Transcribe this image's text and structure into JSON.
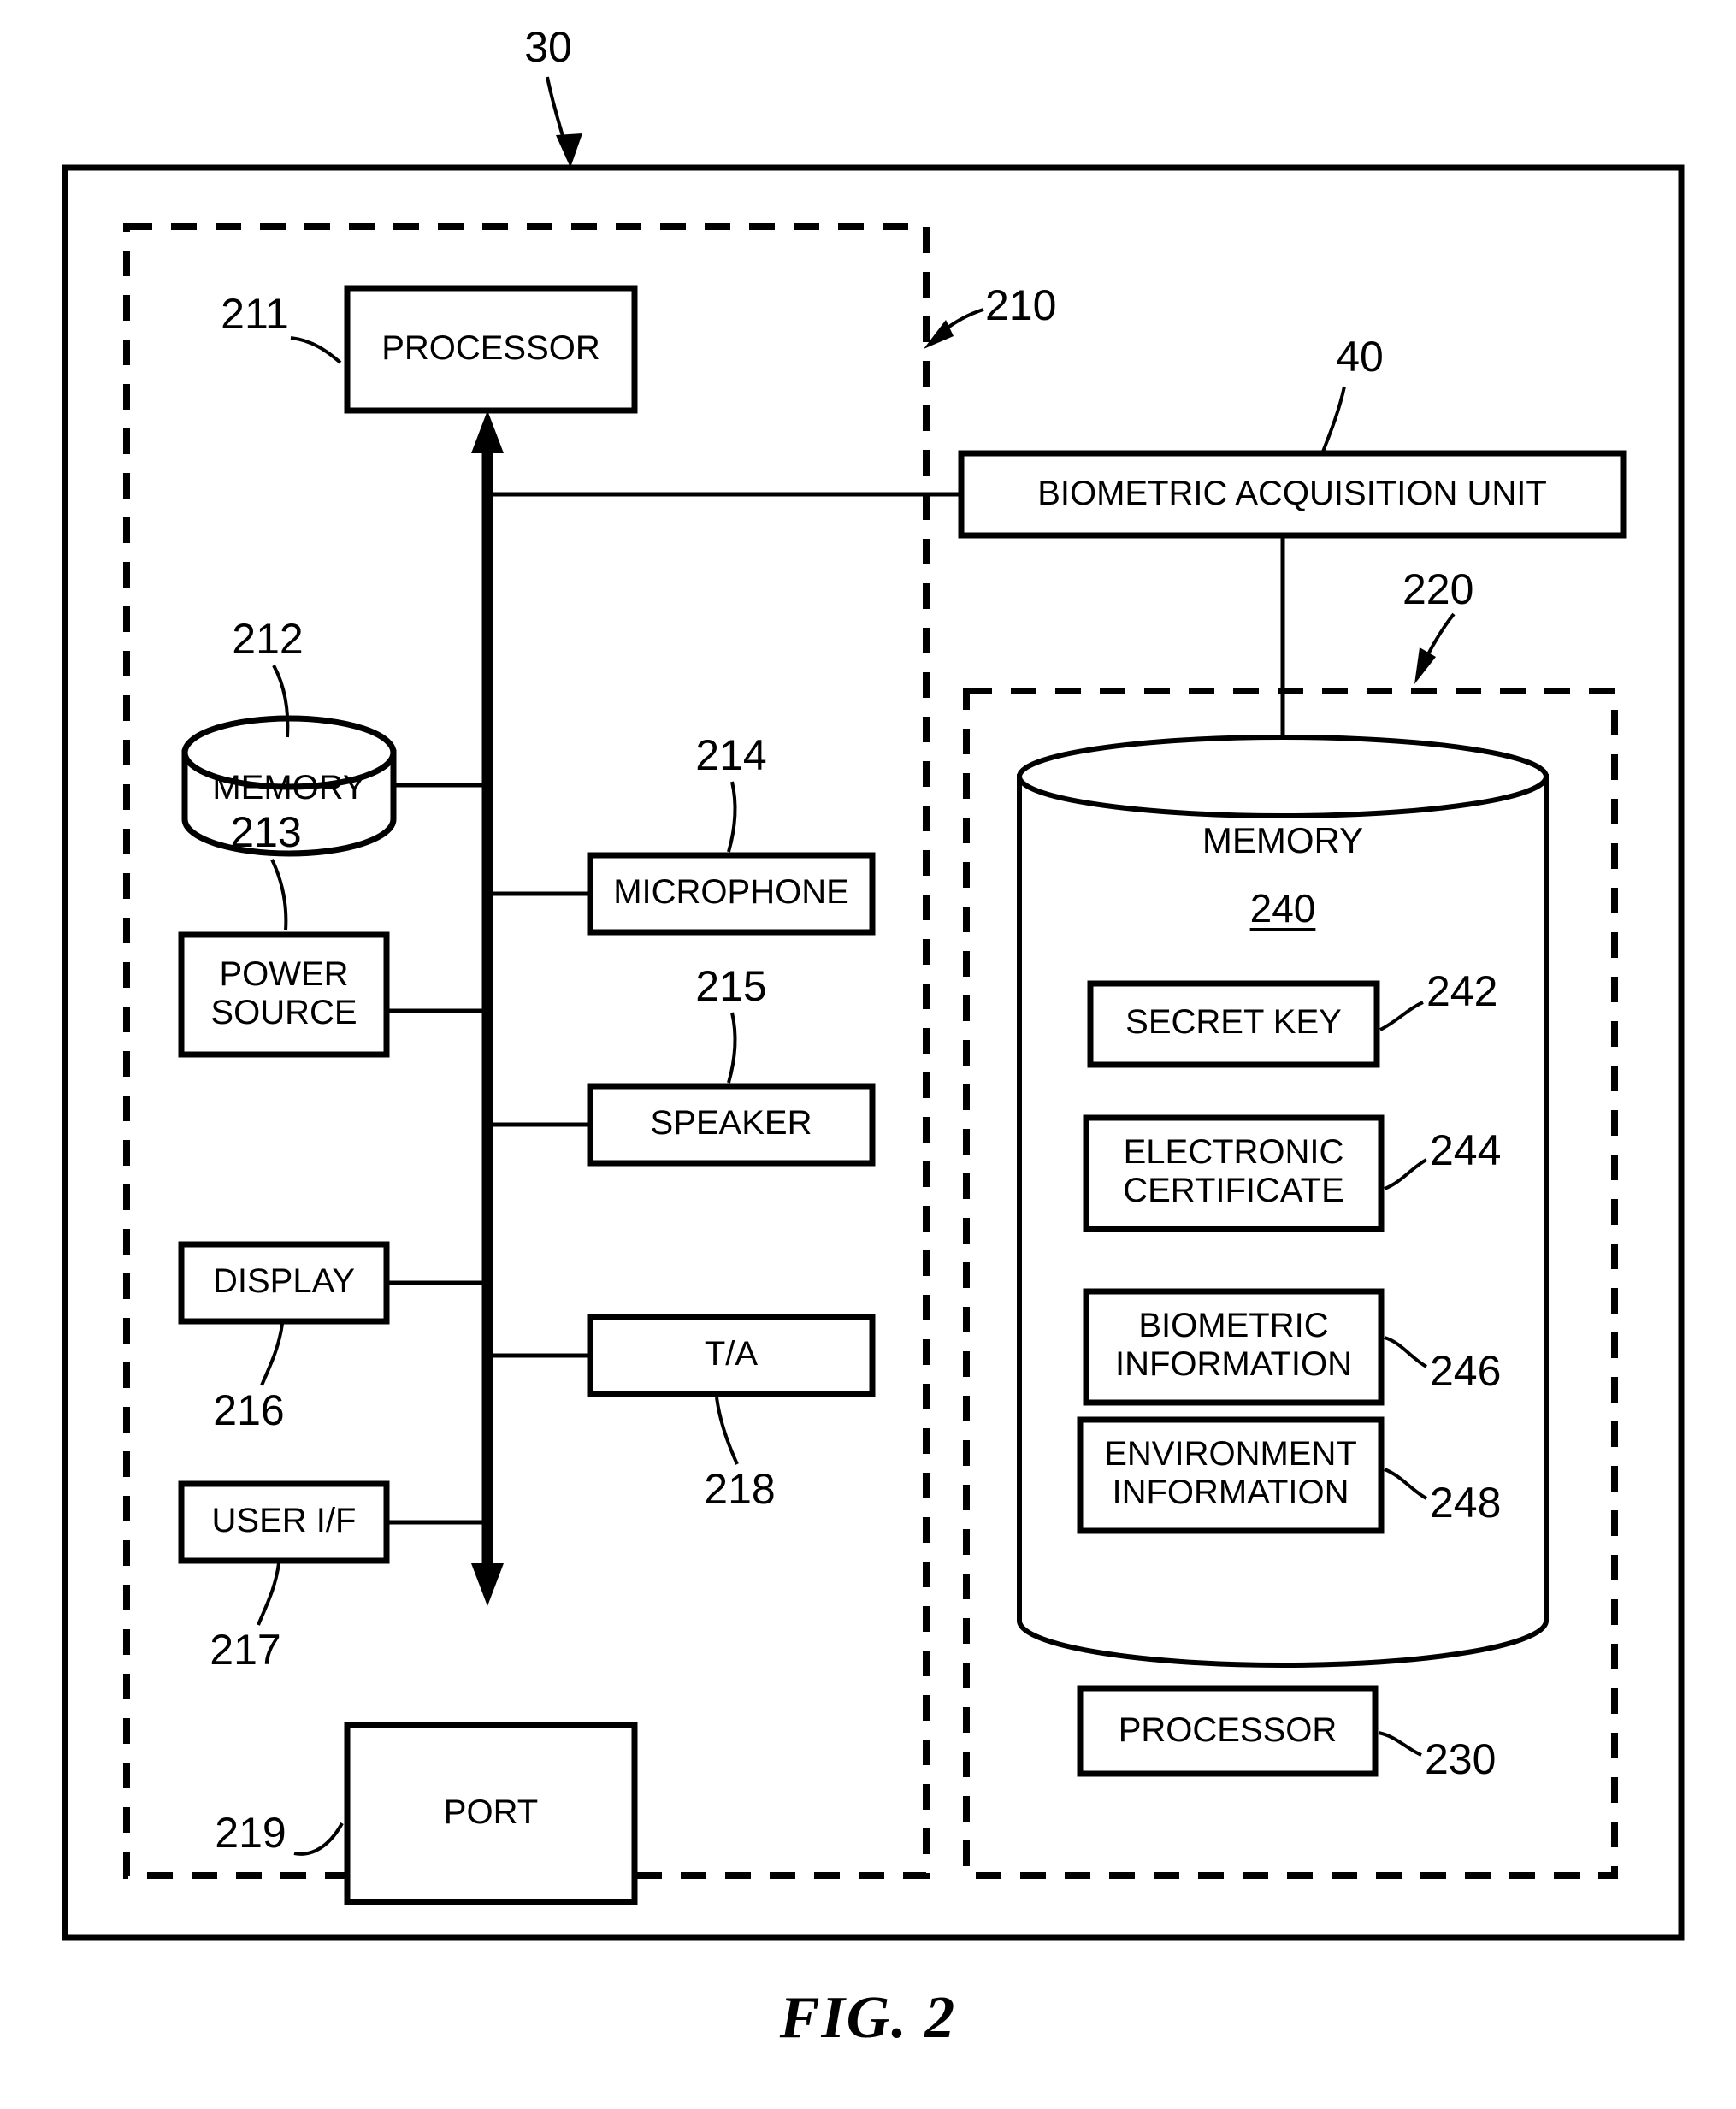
{
  "figure": {
    "caption": "FIG. 2",
    "outer_ref": "30"
  },
  "device_block": {
    "ref": "210",
    "components": [
      {
        "id": "processor",
        "label": "PROCESSOR",
        "ref": "211"
      },
      {
        "id": "memory",
        "label": "MEMORY",
        "ref": "212"
      },
      {
        "id": "power_source",
        "label": "POWER\nSOURCE",
        "ref": "213"
      },
      {
        "id": "microphone",
        "label": "MICROPHONE",
        "ref": "214"
      },
      {
        "id": "speaker",
        "label": "SPEAKER",
        "ref": "215"
      },
      {
        "id": "display",
        "label": "DISPLAY",
        "ref": "216"
      },
      {
        "id": "user_if",
        "label": "USER I/F",
        "ref": "217"
      },
      {
        "id": "ta",
        "label": "T/A",
        "ref": "218"
      },
      {
        "id": "port",
        "label": "PORT",
        "ref": "219"
      }
    ]
  },
  "biometric_acquisition_unit": {
    "label": "BIOMETRIC ACQUISITION UNIT",
    "ref": "40"
  },
  "secure_block": {
    "ref": "220",
    "memory": {
      "title": "MEMORY",
      "ref": "240",
      "items": [
        {
          "id": "secret_key",
          "label": "SECRET KEY",
          "ref": "242"
        },
        {
          "id": "electronic_certificate",
          "label": "ELECTRONIC\nCERTIFICATE",
          "ref": "244"
        },
        {
          "id": "biometric_information",
          "label": "BIOMETRIC\nINFORMATION",
          "ref": "246"
        },
        {
          "id": "environment_information",
          "label": "ENVIRONMENT\nINFORMATION",
          "ref": "248"
        }
      ]
    },
    "processor": {
      "label": "PROCESSOR",
      "ref": "230"
    }
  },
  "colors": {
    "stroke": "#000000",
    "background": "#ffffff"
  }
}
